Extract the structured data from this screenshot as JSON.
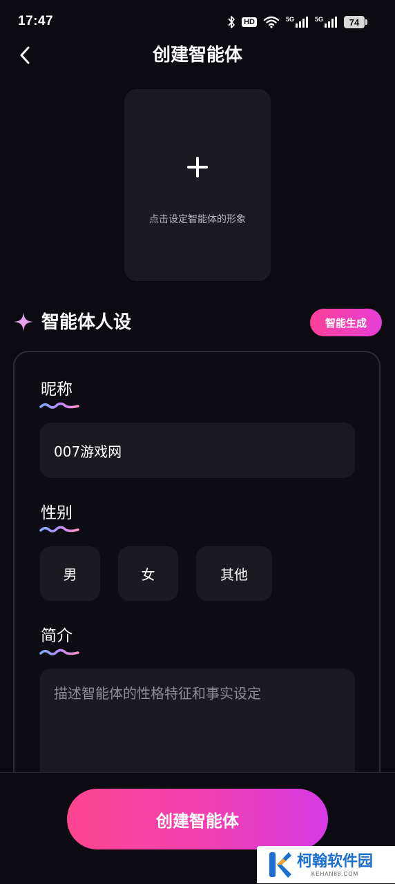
{
  "status_bar": {
    "time": "17:47",
    "hd_label": "HD",
    "network_1": "5G",
    "network_2": "5G",
    "battery": "74",
    "icons": [
      "bluetooth-icon",
      "wifi-icon",
      "signal-icon",
      "signal-icon",
      "battery-icon"
    ]
  },
  "header": {
    "back_icon": "chevron-left-icon",
    "title": "创建智能体"
  },
  "avatar_upload": {
    "icon": "plus-icon",
    "hint": "点击设定智能体的形象"
  },
  "persona_section": {
    "icon": "sparkle-icon",
    "title": "智能体人设",
    "generate_button": "智能生成"
  },
  "form": {
    "nickname": {
      "label": "昵称",
      "value": "007游戏网"
    },
    "gender": {
      "label": "性别",
      "options": [
        "男",
        "女",
        "其他"
      ]
    },
    "intro": {
      "label": "简介",
      "placeholder": "描述智能体的性格特征和事实设定"
    }
  },
  "footer": {
    "create_button": "创建智能体"
  },
  "watermark": {
    "name": "柯翰软件园",
    "sub": "KEHAN88.COM"
  },
  "colors": {
    "background": "#0d0b12",
    "surface": "#1b1a20",
    "accent_pink": "#ff4590",
    "accent_purple": "#d63ae6",
    "watermark_blue": "#1a6fd0"
  }
}
